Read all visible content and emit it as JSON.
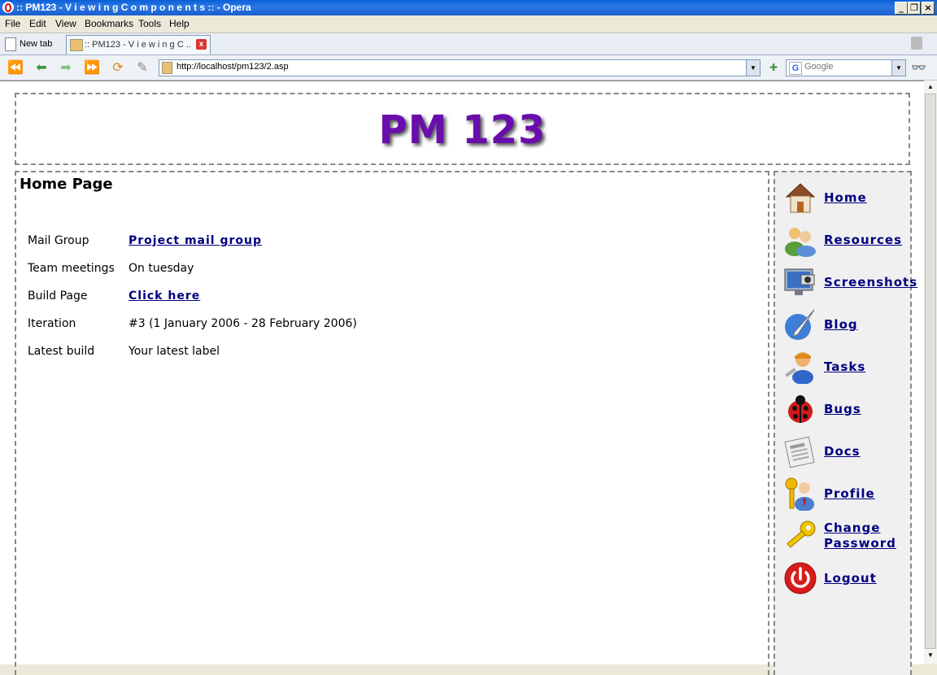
{
  "window": {
    "title": ":: PM123 - V i e w i n g C o m p o n e n t s :: - Opera"
  },
  "menu": [
    "File",
    "Edit",
    "View",
    "Bookmarks",
    "Tools",
    "Help"
  ],
  "tabs": {
    "new_tab_label": "New tab",
    "active_tab_label": ":: PM123 - V i e w i n g C ..."
  },
  "nav": {
    "url": "http://localhost/pm123/2.asp",
    "search_placeholder": "Google"
  },
  "page": {
    "site_title": "PM 123",
    "heading": "Home Page",
    "rows": [
      {
        "label": "Mail Group",
        "value": "Project mail group",
        "is_link": true
      },
      {
        "label": "Team meetings",
        "value": "On tuesday",
        "is_link": false
      },
      {
        "label": "Build Page",
        "value": "Click here",
        "is_link": true
      },
      {
        "label": "Iteration",
        "value": "#3 (1 January 2006 - 28 February 2006)",
        "is_link": false
      },
      {
        "label": "Latest build",
        "value": "Your latest label",
        "is_link": false
      }
    ]
  },
  "sidebar": {
    "items": [
      {
        "label": "Home",
        "icon": "house-icon"
      },
      {
        "label": "Resources",
        "icon": "people-icon"
      },
      {
        "label": "Screenshots",
        "icon": "monitor-camera-icon"
      },
      {
        "label": "Blog",
        "icon": "quill-globe-icon"
      },
      {
        "label": "Tasks",
        "icon": "worker-icon"
      },
      {
        "label": "Bugs",
        "icon": "ladybug-icon"
      },
      {
        "label": "Docs",
        "icon": "newspaper-icon"
      },
      {
        "label": "Profile",
        "icon": "profile-key-icon"
      },
      {
        "label": "Change Password",
        "icon": "key-icon"
      },
      {
        "label": "Logout",
        "icon": "power-icon"
      }
    ]
  }
}
